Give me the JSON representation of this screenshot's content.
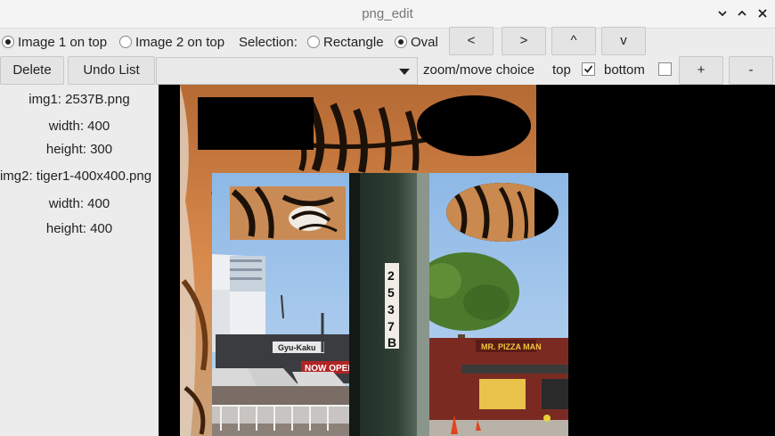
{
  "window": {
    "title": "png_edit",
    "controls": [
      "minimize-icon",
      "maximize-icon",
      "close-icon"
    ]
  },
  "toolbar": {
    "stacking": {
      "option1": "Image 1 on top",
      "option2": "Image 2 on top",
      "selected": "option1"
    },
    "selection_label": "Selection:",
    "selection": {
      "rectangle": "Rectangle",
      "oval": "Oval",
      "selected": "oval"
    },
    "nav": {
      "left": "<",
      "right": ">",
      "up": "^",
      "down": "v"
    },
    "delete_label": "Delete",
    "undo_label": "Undo List",
    "combo_value": "",
    "zoom_label": "zoom/move choice",
    "top_label": "top",
    "top_checked": true,
    "bottom_label": "bottom",
    "bottom_checked": false,
    "zoom_in": "+",
    "zoom_out": "-"
  },
  "sidebar": {
    "img1_name": "img1: 2537B.png",
    "img1_width": "width: 400",
    "img1_height": "height: 300",
    "img2_name": "img2: tiger1-400x400.png",
    "img2_width": "width: 400",
    "img2_height": "height: 400"
  },
  "canvas": {
    "pole_label_chars": [
      "2",
      "5",
      "3",
      "7",
      "B"
    ],
    "signs": [
      "Gyu-Kaku",
      "NOW OPEN",
      "MR. PIZZA MAN"
    ],
    "colors": {
      "background": "#000000",
      "tiger_orange": "#c06a2e",
      "sky": "#9ec3ea"
    }
  }
}
